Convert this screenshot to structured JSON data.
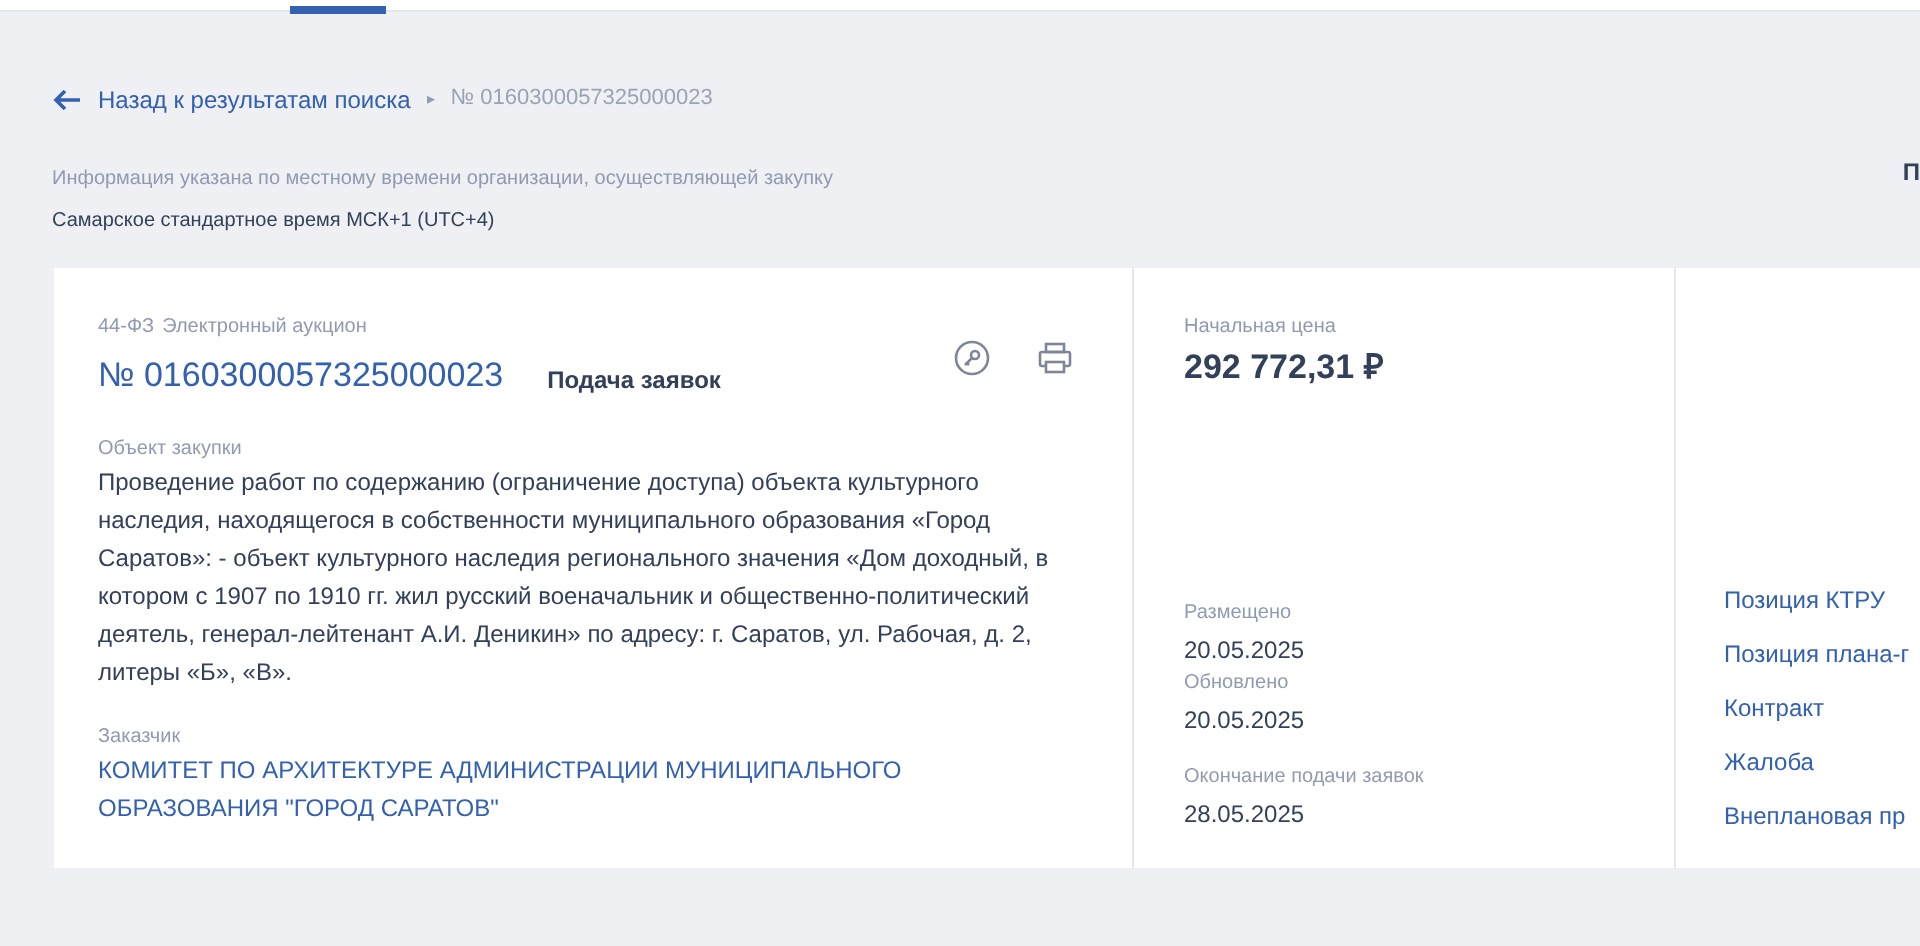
{
  "breadcrumb": {
    "back_link": "Назад к результатам поиска",
    "separator": "▸",
    "current": "№ 0160300057325000023"
  },
  "timezone": {
    "note": "Информация указана по местному времени организации, осуществляющей закупку",
    "zone": "Самарское стандартное время МСК+1 (UTC+4)"
  },
  "edge_text": "П",
  "purchase": {
    "law": "44-ФЗ",
    "method": "Электронный аукцион",
    "number": "№ 0160300057325000023",
    "stage": "Подача заявок",
    "object_label": "Объект закупки",
    "object": "Проведение работ по содержанию (ограничение доступа) объекта культурного наследия, находящегося в собственности муниципального образования «Город Саратов»: - объект культурного наследия регионального значения «Дом доходный, в котором с 1907 по 1910 гг. жил русский военачальник и общественно-политический деятель, генерал-лейтенант А.И. Деникин» по адресу: г. Саратов, ул. Рабочая, д. 2, литеры «Б», «В».",
    "customer_label": "Заказчик",
    "customer": "КОМИТЕТ ПО АРХИТЕКТУРЕ АДМИНИСТРАЦИИ МУНИЦИПАЛЬНОГО ОБРАЗОВАНИЯ \"ГОРОД САРАТОВ\""
  },
  "price": {
    "label": "Начальная цена",
    "value": "292 772,31 ₽"
  },
  "dates": [
    {
      "label": "Размещено",
      "value": "20.05.2025"
    },
    {
      "label": "Обновлено",
      "value": "20.05.2025"
    },
    {
      "label": "Окончание подачи заявок",
      "value": "28.05.2025"
    }
  ],
  "links": [
    "Позиция КТРУ",
    "Позиция плана-г",
    "Контракт",
    "Жалоба",
    "Внеплановая пр"
  ]
}
